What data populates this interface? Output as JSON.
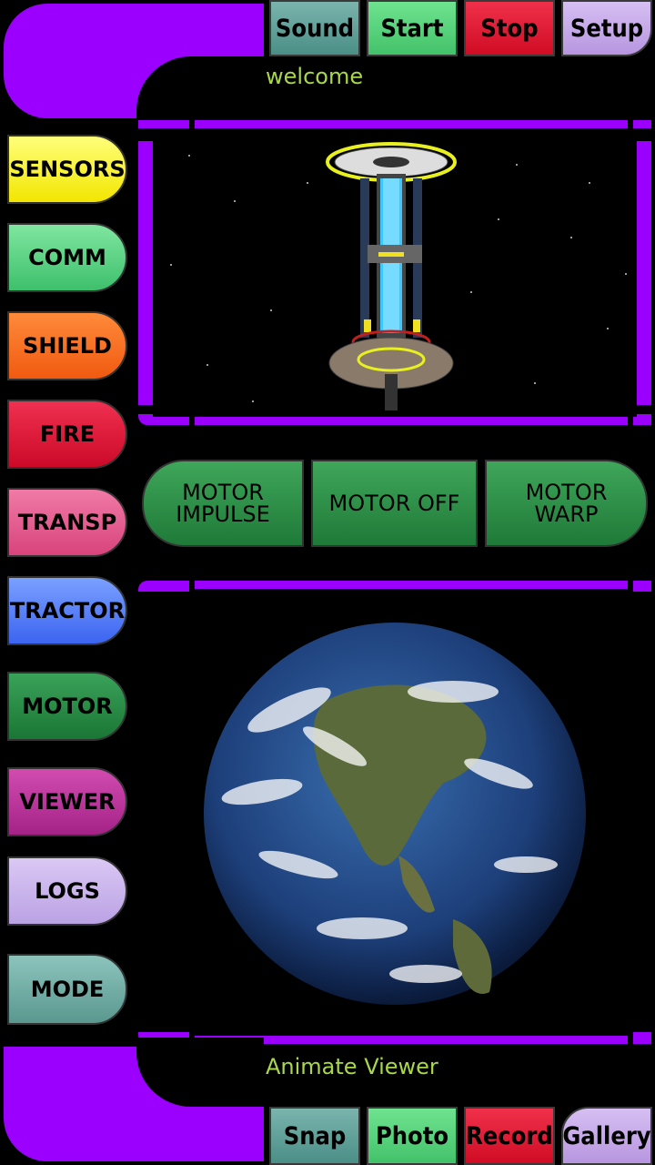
{
  "top_buttons": [
    "Sound",
    "Start",
    "Stop",
    "Setup"
  ],
  "bottom_buttons": [
    "Snap",
    "Photo",
    "Record",
    "Gallery"
  ],
  "header_text": "welcome",
  "footer_text": "Animate Viewer",
  "side_buttons": [
    "SENSORS",
    "COMM",
    "SHIELD",
    "FIRE",
    "TRANSP",
    "TRACTOR",
    "MOTOR",
    "VIEWER",
    "LOGS",
    "MODE"
  ],
  "motor_buttons": [
    "MOTOR\nIMPULSE",
    "MOTOR OFF",
    "MOTOR\nWARP"
  ],
  "colors": {
    "frame": "#9b00ff",
    "label": "#a8d84a",
    "sound": "#5f9e96",
    "start": "#5fd27f",
    "stop": "#e8122e",
    "setup": "#c6a8ea"
  }
}
